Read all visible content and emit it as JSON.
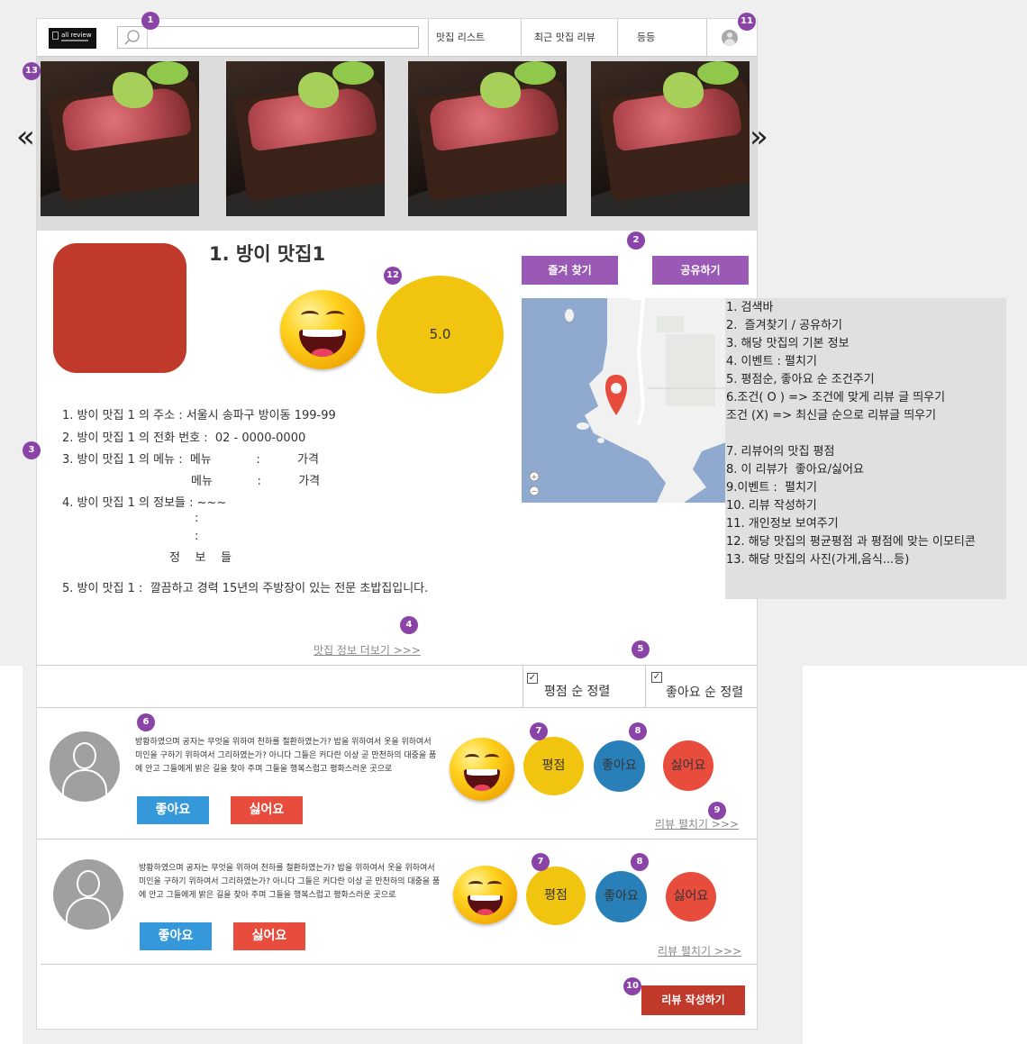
{
  "header": {
    "logo_text": "all review",
    "search_placeholder": "",
    "nav": [
      "맛집 리스트",
      "최근 맛집 리뷰",
      "등등"
    ]
  },
  "badges": [
    "1",
    "2",
    "3",
    "4",
    "5",
    "6",
    "7",
    "8",
    "9",
    "10",
    "11",
    "12",
    "13"
  ],
  "gallery": {
    "prev": "«",
    "next": "»",
    "photo_count": 4
  },
  "restaurant": {
    "title": "1. 방이 맛집1",
    "score": "5.0",
    "favorite_label": "즐겨 찾기",
    "share_label": "공유하기",
    "info_lines": [
      "1. 방이 맛집 1 의 주소 : 서울시 송파구 방이동 199-99",
      "2. 방이 맛집 1 의 전화 번호 :  02 - 0000-0000",
      "3. 방이 맛집 1 의 메뉴 :  메뉴            :          가격",
      "메뉴            :          가격",
      "4. 방이 맛집 1 의 정보들 : ~~~",
      ":",
      ":",
      "정    보    들",
      "5. 방이 맛집 1 :  깔끔하고 경력 15년의 주방장이 있는 전문 초밥집입니다."
    ],
    "more_link": "맛집 정보 더보기 >>>"
  },
  "notes": [
    "1. 검색바",
    "2.  즐겨찾기 / 공유하기",
    "3. 해당 맛집의 기본 정보",
    "4. 이벤트 : 펼치기",
    "5. 평점순, 좋아요 순 조건주기",
    "6.조건( O ) => 조건에 맞게 리뷰 글 띄우기",
    "조건 (X) => 최신글 순으로 리뷰글 띄우기",
    "",
    "7. 리뷰어의 맛집 평점",
    "8. 이 리뷰가  좋아요/싫어요",
    "9.이벤트 :  펼치기",
    "10. 리뷰 작성하기",
    "11. 개인정보 보여주기",
    "12. 해당 맛집의 평균평점 과 평점에 맞는 이모티콘",
    "13. 해당 맛집의 사진(가게,음식...등)"
  ],
  "sort": {
    "rating": "평점 순 정렬",
    "likes": "좋아요 순 정렬",
    "check": "✓"
  },
  "reviews": [
    {
      "text": "방황하였으며 공자는 무엇을 위하여 천하를 철환하였는가? 밥을 위하여서 옷을 위하여서 미인을 구하기 위하여서 그리하였는가? 아니다 그들은 커다란 이상 곧 만천하의 대중을 품에 안고 그들에게 밝은 길을 찾아 주며 그들을 행복스럽고 평화스러운 곳으로",
      "like_btn": "좋아요",
      "dislike_btn": "싫어요",
      "rating_label": "평점",
      "like_label": "좋아요",
      "dislike_label": "싫어요",
      "expand": "리뷰 펼치기 >>>"
    },
    {
      "text": "방황하였으며 공자는 무엇을 위하여 천하를 철환하였는가? 밥을 위하여서 옷을 위하여서 미인을 구하기 위하여서 그리하였는가? 아니다 그들은 커다란 이상 곧 만천하의 대중을 품에 안고 그들에게 밝은 길을 찾아 주며 그들을 행복스럽고 평화스러운 곳으로",
      "like_btn": "좋아요",
      "dislike_btn": "싫어요",
      "rating_label": "평점",
      "like_label": "좋아요",
      "dislike_label": "싫어요",
      "expand": "리뷰 펼치기 >>>"
    }
  ],
  "write_review": "리뷰 작성하기",
  "colors": {
    "badge": "#8a44a8",
    "purple_btn": "#9b59b6",
    "blue": "#3498db",
    "red": "#e74c3c",
    "yellow": "#f1c40f",
    "dark_red": "#c0392b"
  }
}
